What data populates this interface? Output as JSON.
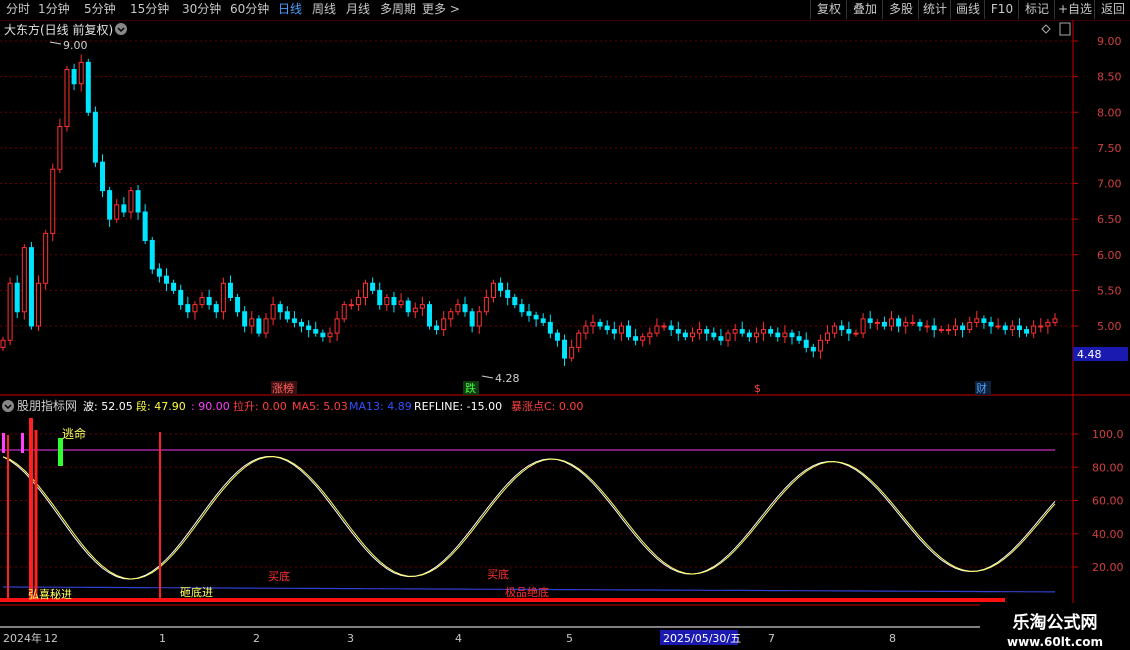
{
  "toolbar": {
    "left": [
      "分时",
      "1分钟",
      "5分钟",
      "15分钟",
      "30分钟",
      "60分钟",
      "日线",
      "周线",
      "月线",
      "多周期",
      "更多 >"
    ],
    "active": "日线",
    "right": [
      "复权",
      "叠加",
      "多股",
      "统计",
      "画线",
      "F10",
      "标记",
      "+自选",
      "返回"
    ]
  },
  "main": {
    "title": "大东方(日线 前复权)",
    "y_ticks": [
      "9.00",
      "8.50",
      "8.00",
      "7.50",
      "7.00",
      "6.50",
      "6.00",
      "5.50",
      "5.00"
    ],
    "high_label": "9.00",
    "low_label": "4.28",
    "price_tag": "4.48",
    "markers": [
      {
        "text": "涨榜",
        "color": "#ff6060"
      },
      {
        "text": "跌",
        "color": "#40ff40"
      },
      {
        "text": "$",
        "color": "#ff4040"
      },
      {
        "text": "财",
        "color": "#4aa0ff"
      }
    ]
  },
  "indicator": {
    "name": "股朋指标网",
    "values": [
      {
        "label": "波: 52.05",
        "color": "#ffffff"
      },
      {
        "label": "段: 47.90",
        "color": "#ffff40"
      },
      {
        "label": ": 90.00",
        "color": "#ff40ff"
      },
      {
        "label": "拉升: 0.00",
        "color": "#ff4040"
      },
      {
        "label": "MA5: 5.03",
        "color": "#ff4040"
      },
      {
        "label": "MA13: 4.89",
        "color": "#3050ff"
      },
      {
        "label": "REFLINE: -15.00",
        "color": "#ffffff"
      },
      {
        "label": "暴涨点C: 0.00",
        "color": "#ff4040"
      }
    ],
    "y_ticks": [
      "100.0",
      "80.00",
      "60.00",
      "40.00",
      "20.00"
    ],
    "annotations": [
      "逃命",
      "弘喜秘进",
      "砸底进",
      "买底",
      "买底",
      "极品绝底"
    ]
  },
  "axis": {
    "labels": [
      "2024年",
      "12",
      "1",
      "2",
      "3",
      "4",
      "5",
      "2025/05/30/五",
      "7",
      "8"
    ]
  },
  "watermark": {
    "line1": "乐淘公式网",
    "line2": "www.60lt.com"
  },
  "colors": {
    "up": "#ff3030",
    "down": "#00e5ff",
    "grid": "#7a0000",
    "axis": "#c80000"
  },
  "chart_data": {
    "type": "candlestick",
    "ylim": [
      4.2,
      9.2
    ],
    "close": [
      4.8,
      5.6,
      5.2,
      6.1,
      5.0,
      5.6,
      6.3,
      7.2,
      7.8,
      8.6,
      8.4,
      8.7,
      8.0,
      7.3,
      6.9,
      6.5,
      6.7,
      6.6,
      6.9,
      6.6,
      6.2,
      5.8,
      5.7,
      5.6,
      5.5,
      5.3,
      5.2,
      5.3,
      5.4,
      5.3,
      5.2,
      5.6,
      5.4,
      5.2,
      5.0,
      5.1,
      4.9,
      5.1,
      5.3,
      5.2,
      5.1,
      5.05,
      5.0,
      4.95,
      4.9,
      4.85,
      4.9,
      5.1,
      5.3,
      5.3,
      5.4,
      5.6,
      5.5,
      5.3,
      5.4,
      5.3,
      5.35,
      5.2,
      5.25,
      5.3,
      5.0,
      4.95,
      5.1,
      5.2,
      5.3,
      5.2,
      5.0,
      5.2,
      5.4,
      5.6,
      5.5,
      5.4,
      5.3,
      5.2,
      5.15,
      5.1,
      5.05,
      4.9,
      4.8,
      4.55,
      4.7,
      4.9,
      5.0,
      5.05,
      5.0,
      4.95,
      4.9,
      5.0,
      4.85,
      4.8,
      4.85,
      4.9,
      5.0,
      5.0,
      4.95,
      4.9,
      4.85,
      4.9,
      4.95,
      4.9,
      4.85,
      4.8,
      4.9,
      4.95,
      4.9,
      4.85,
      4.9,
      4.95,
      4.9,
      4.85,
      4.9,
      4.85,
      4.8,
      4.7,
      4.65,
      4.8,
      4.9,
      5.0,
      4.95,
      4.9,
      4.9,
      5.1,
      5.05,
      5.05,
      5.0,
      5.1,
      5.0,
      5.05,
      5.05,
      5.0,
      5.0,
      4.95,
      4.95,
      4.95,
      5.0,
      4.95,
      5.05,
      5.1,
      5.05,
      5.0,
      5.0,
      4.95,
      5.0,
      4.95,
      4.9,
      5.0,
      5.0,
      5.05,
      5.1
    ]
  }
}
